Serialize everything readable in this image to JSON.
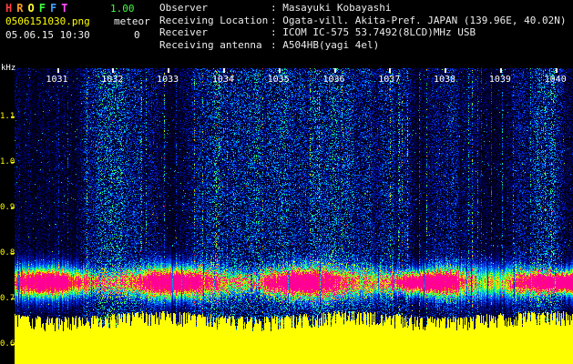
{
  "app": {
    "title_letters": [
      "H",
      "R",
      "O",
      "F",
      "F",
      "T"
    ],
    "title_colors": [
      "#ff4040",
      "#ff9c20",
      "#ffff30",
      "#40ff40",
      "#40a0ff",
      "#ff50ff"
    ],
    "version": "1.00",
    "version_color": "#40ff40"
  },
  "capture": {
    "filename": "0506151030.png",
    "mode": "meteor",
    "datetime": "05.06.15 10:30",
    "count": "0"
  },
  "station": {
    "label_separator": ":",
    "rows": [
      {
        "label": "Observer",
        "value": "Masayuki Kobayashi"
      },
      {
        "label": "Receiving Location",
        "value": "Ogata-vill. Akita-Pref. JAPAN (139.96E, 40.02N)"
      },
      {
        "label": "Receiver",
        "value": "ICOM IC-575 53.7492(8LCD)MHz USB"
      },
      {
        "label": "Receiving antenna",
        "value": "A504HB(yagi 4el)"
      }
    ]
  },
  "spectrogram": {
    "y_axis_unit": "kHz",
    "y_tick_labels": [
      "1.1",
      "1.0",
      "0.9",
      "0.8",
      "0.7",
      "0.6"
    ],
    "time_labels": [
      "1031",
      "1032",
      "1033",
      "1034",
      "1035",
      "1036",
      "1037",
      "1038",
      "1039",
      "1040"
    ],
    "colors": {
      "background": "#000000",
      "noise_low": "#0000c0",
      "noise_mid": "#00c8ff",
      "signal_band": "#ff0096",
      "saturation_band": "#ffff00",
      "axis_text": "#ffff00",
      "time_text": "#ffffff"
    }
  }
}
